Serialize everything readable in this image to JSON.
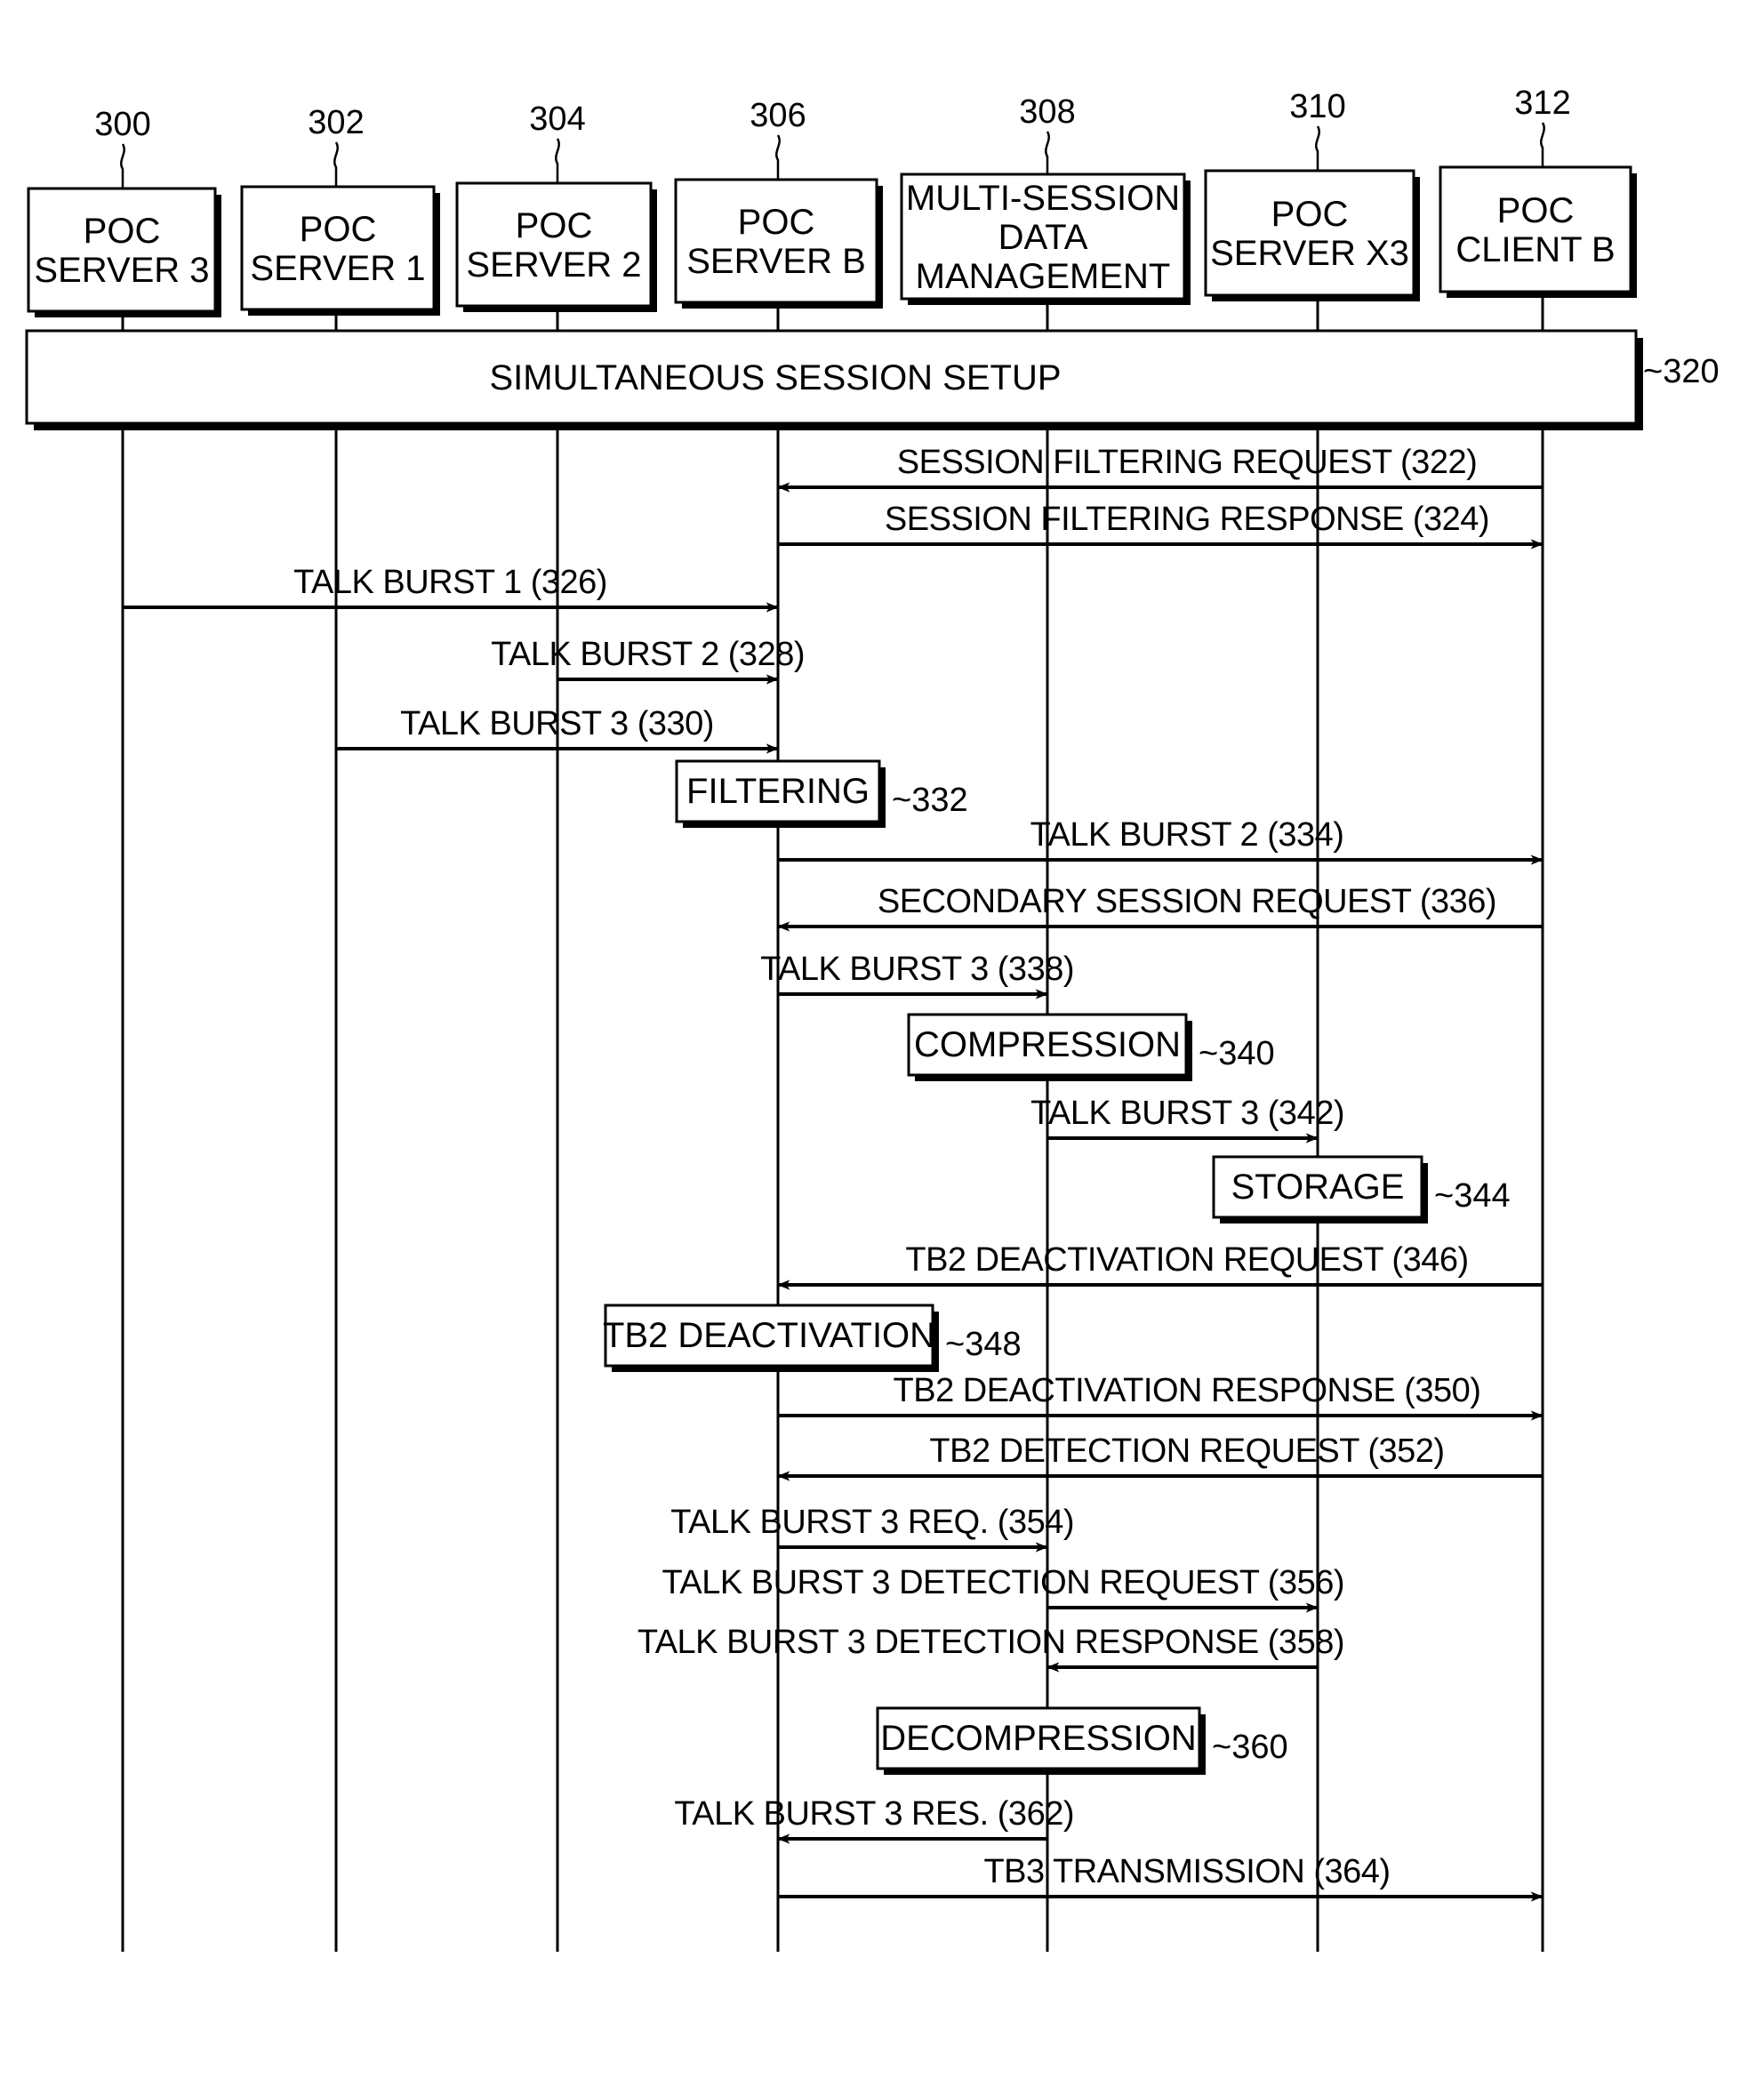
{
  "diagram": {
    "type": "sequence",
    "participants": [
      {
        "ref": "300",
        "lines": [
          "POC",
          "SERVER 3"
        ]
      },
      {
        "ref": "302",
        "lines": [
          "POC",
          "SERVER 1"
        ]
      },
      {
        "ref": "304",
        "lines": [
          "POC",
          "SERVER 2"
        ]
      },
      {
        "ref": "306",
        "lines": [
          "POC",
          "SERVER B"
        ]
      },
      {
        "ref": "308",
        "lines": [
          "MULTI-SESSION",
          "DATA",
          "MANAGEMENT"
        ]
      },
      {
        "ref": "310",
        "lines": [
          "POC",
          "SERVER X3"
        ]
      },
      {
        "ref": "312",
        "lines": [
          "POC",
          "CLIENT B"
        ]
      }
    ],
    "setup": {
      "label": "SIMULTANEOUS SESSION SETUP",
      "ref": "~320"
    },
    "steps": [
      {
        "kind": "msg",
        "from": 6,
        "to": 3,
        "label": "SESSION FILTERING REQUEST (322)"
      },
      {
        "kind": "msg",
        "from": 3,
        "to": 6,
        "label": "SESSION FILTERING RESPONSE (324)"
      },
      {
        "kind": "msg",
        "from": 0,
        "to": 3,
        "label": "TALK BURST 1 (326)"
      },
      {
        "kind": "msg",
        "from": 2,
        "to": 3,
        "label": "TALK BURST 2 (328)"
      },
      {
        "kind": "msg",
        "from": 1,
        "to": 3,
        "label": "TALK BURST 3 (330)"
      },
      {
        "kind": "proc",
        "at": 3,
        "label": "FILTERING",
        "ref": "~332"
      },
      {
        "kind": "msg",
        "from": 3,
        "to": 6,
        "label": "TALK BURST 2 (334)"
      },
      {
        "kind": "msg",
        "from": 6,
        "to": 3,
        "label": "SECONDARY SESSION REQUEST (336)"
      },
      {
        "kind": "msg",
        "from": 3,
        "to": 4,
        "label": "TALK BURST 3 (338)"
      },
      {
        "kind": "proc",
        "at": 4,
        "label": "COMPRESSION",
        "ref": "~340"
      },
      {
        "kind": "msg",
        "from": 4,
        "to": 5,
        "label": "TALK BURST 3 (342)"
      },
      {
        "kind": "proc",
        "at": 5,
        "label": "STORAGE",
        "ref": "~344"
      },
      {
        "kind": "msg",
        "from": 6,
        "to": 3,
        "label": "TB2 DEACTIVATION REQUEST (346)"
      },
      {
        "kind": "proc",
        "at": 3,
        "label": "TB2 DEACTIVATION",
        "ref": "~348"
      },
      {
        "kind": "msg",
        "from": 3,
        "to": 6,
        "label": "TB2 DEACTIVATION RESPONSE (350)"
      },
      {
        "kind": "msg",
        "from": 6,
        "to": 3,
        "label": "TB2 DETECTION REQUEST (352)"
      },
      {
        "kind": "msg",
        "from": 3,
        "to": 4,
        "label": "TALK BURST 3 REQ. (354)"
      },
      {
        "kind": "msg",
        "from": 4,
        "to": 5,
        "label": "TALK BURST 3 DETECTION REQUEST (356)"
      },
      {
        "kind": "msg",
        "from": 5,
        "to": 4,
        "label": "TALK BURST 3 DETECTION RESPONSE (358)"
      },
      {
        "kind": "proc",
        "at": 4,
        "label": "DECOMPRESSION",
        "ref": "~360"
      },
      {
        "kind": "msg",
        "from": 4,
        "to": 3,
        "label": "TALK BURST 3 RES. (362)"
      },
      {
        "kind": "msg",
        "from": 3,
        "to": 6,
        "label": "TB3 TRANSMISSION (364)"
      }
    ]
  }
}
